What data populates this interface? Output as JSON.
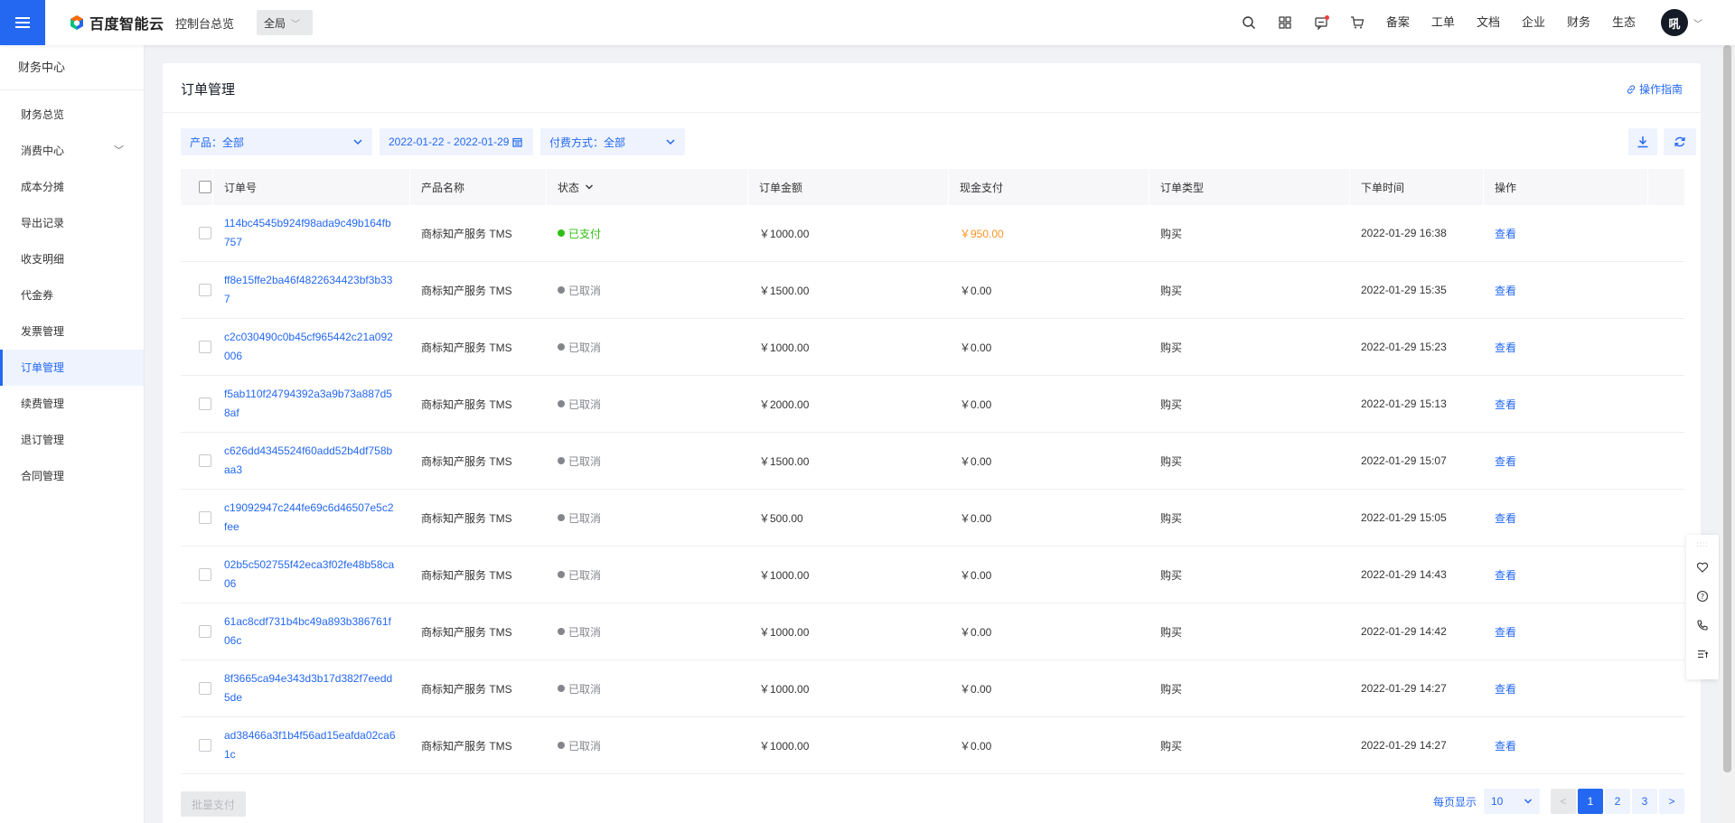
{
  "header": {
    "brand": "百度智能云",
    "console_link": "控制台总览",
    "region": "全局",
    "links": [
      "备案",
      "工单",
      "文档",
      "企业",
      "财务",
      "生态"
    ],
    "avatar": "吼",
    "brand_color": "#2468f2"
  },
  "sidebar": {
    "title": "财务中心",
    "items": [
      {
        "label": "财务总览"
      },
      {
        "label": "消费中心"
      },
      {
        "label": "成本分摊"
      },
      {
        "label": "导出记录"
      },
      {
        "label": "收支明细"
      },
      {
        "label": "代金券"
      },
      {
        "label": "发票管理"
      },
      {
        "label": "订单管理"
      },
      {
        "label": "续费管理"
      },
      {
        "label": "退订管理"
      },
      {
        "label": "合同管理"
      }
    ]
  },
  "page": {
    "title": "订单管理",
    "guide": "操作指南"
  },
  "filters": {
    "product": "产品：全部",
    "date_range": "2022-01-22 - 2022-01-29",
    "pay_method": "付费方式：全部"
  },
  "table": {
    "headers": {
      "order_id": "订单号",
      "product": "产品名称",
      "status": "状态",
      "amount": "订单金额",
      "cash": "现金支付",
      "type": "订单类型",
      "time": "下单时间",
      "op": "操作"
    },
    "rows": [
      {
        "id": "114bc4545b924f98ada9c49b164fb757",
        "product": "商标知产服务 TMS",
        "status": "已支付",
        "amount": "￥1000.00",
        "cash": "￥950.00",
        "type": "购买",
        "time": "2022-01-29 16:38",
        "op": "查看"
      },
      {
        "id": "ff8e15ffe2ba46f4822634423bf3b337",
        "product": "商标知产服务 TMS",
        "status": "已取消",
        "amount": "￥1500.00",
        "cash": "￥0.00",
        "type": "购买",
        "time": "2022-01-29 15:35",
        "op": "查看"
      },
      {
        "id": "c2c030490c0b45cf965442c21a092006",
        "product": "商标知产服务 TMS",
        "status": "已取消",
        "amount": "￥1000.00",
        "cash": "￥0.00",
        "type": "购买",
        "time": "2022-01-29 15:23",
        "op": "查看"
      },
      {
        "id": "f5ab110f24794392a3a9b73a887d58af",
        "product": "商标知产服务 TMS",
        "status": "已取消",
        "amount": "￥2000.00",
        "cash": "￥0.00",
        "type": "购买",
        "time": "2022-01-29 15:13",
        "op": "查看"
      },
      {
        "id": "c626dd4345524f60add52b4df758baa3",
        "product": "商标知产服务 TMS",
        "status": "已取消",
        "amount": "￥1500.00",
        "cash": "￥0.00",
        "type": "购买",
        "time": "2022-01-29 15:07",
        "op": "查看"
      },
      {
        "id": "c19092947c244fe69c6d46507e5c2fee",
        "product": "商标知产服务 TMS",
        "status": "已取消",
        "amount": "￥500.00",
        "cash": "￥0.00",
        "type": "购买",
        "time": "2022-01-29 15:05",
        "op": "查看"
      },
      {
        "id": "02b5c502755f42eca3f02fe48b58ca06",
        "product": "商标知产服务 TMS",
        "status": "已取消",
        "amount": "￥1000.00",
        "cash": "￥0.00",
        "type": "购买",
        "time": "2022-01-29 14:43",
        "op": "查看"
      },
      {
        "id": "61ac8cdf731b4bc49a893b386761f06c",
        "product": "商标知产服务 TMS",
        "status": "已取消",
        "amount": "￥1000.00",
        "cash": "￥0.00",
        "type": "购买",
        "time": "2022-01-29 14:42",
        "op": "查看"
      },
      {
        "id": "8f3665ca94e343d3b17d382f7eedd5de",
        "product": "商标知产服务 TMS",
        "status": "已取消",
        "amount": "￥1000.00",
        "cash": "￥0.00",
        "type": "购买",
        "time": "2022-01-29 14:27",
        "op": "查看"
      },
      {
        "id": "ad38466a3f1b4f56ad15eafda02ca61c",
        "product": "商标知产服务 TMS",
        "status": "已取消",
        "amount": "￥1000.00",
        "cash": "￥0.00",
        "type": "购买",
        "time": "2022-01-29 14:27",
        "op": "查看"
      }
    ]
  },
  "footer": {
    "batch_pay": "批量支付",
    "per_page_label": "每页显示",
    "per_page": "10",
    "pages": [
      "1",
      "2",
      "3"
    ],
    "prev": "<",
    "next": ">"
  }
}
